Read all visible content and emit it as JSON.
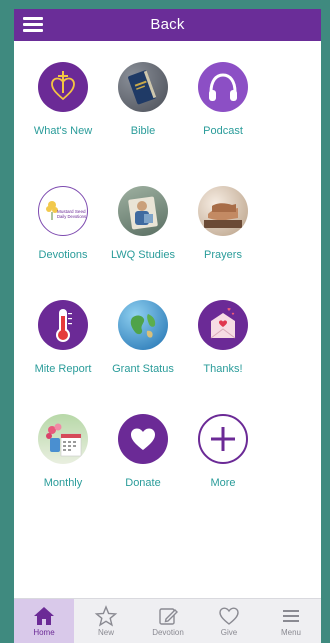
{
  "header": {
    "title": "Back",
    "menu_icon": "hamburger-icon"
  },
  "colors": {
    "brand": "#6a2d98",
    "label": "#2a9c9a",
    "background": "#3f8a7f"
  },
  "tiles": [
    {
      "label": "What's New",
      "icon": "cross-heart-icon"
    },
    {
      "label": "Bible",
      "icon": "bible-photo"
    },
    {
      "label": "Podcast",
      "icon": "headphones-icon"
    },
    {
      "label": "Devotions",
      "icon": "devotions-logo"
    },
    {
      "label": "LWQ Studies",
      "icon": "studies-photo"
    },
    {
      "label": "Prayers",
      "icon": "praying-hands-photo"
    },
    {
      "label": "Mite Report",
      "icon": "thermometer-icon"
    },
    {
      "label": "Grant Status",
      "icon": "globe-photo"
    },
    {
      "label": "Thanks!",
      "icon": "love-letter-icon"
    },
    {
      "label": "Monthly",
      "icon": "calendar-flowers-photo"
    },
    {
      "label": "Donate",
      "icon": "heart-icon"
    },
    {
      "label": "More",
      "icon": "plus-icon"
    }
  ],
  "devotions_logo_text": [
    "Mustard Seed",
    "Daily Devotions"
  ],
  "bottom_nav": [
    {
      "label": "Home",
      "icon": "home-icon",
      "active": true
    },
    {
      "label": "New",
      "icon": "star-icon",
      "active": false
    },
    {
      "label": "Devotion",
      "icon": "edit-icon",
      "active": false
    },
    {
      "label": "Give",
      "icon": "heart-outline-icon",
      "active": false
    },
    {
      "label": "Menu",
      "icon": "menu-icon",
      "active": false
    }
  ]
}
